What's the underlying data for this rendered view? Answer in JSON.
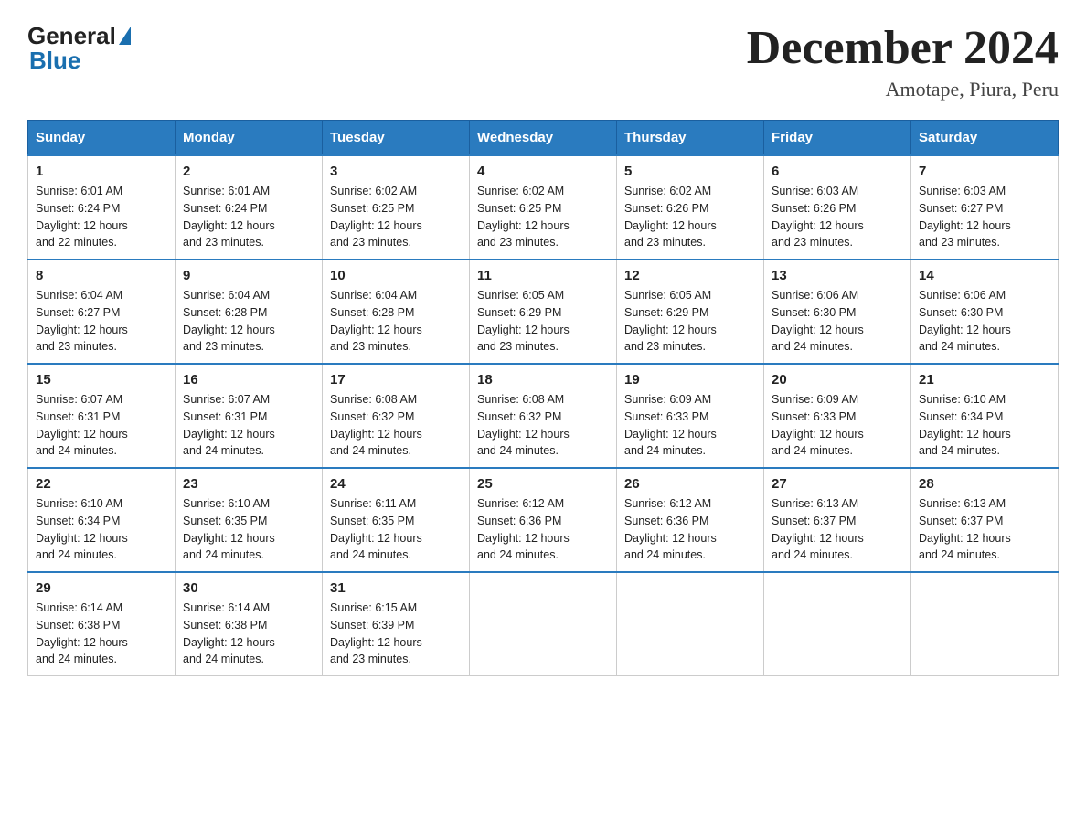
{
  "header": {
    "logo_general": "General",
    "logo_blue": "Blue",
    "month_year": "December 2024",
    "location": "Amotape, Piura, Peru"
  },
  "days_of_week": [
    "Sunday",
    "Monday",
    "Tuesday",
    "Wednesday",
    "Thursday",
    "Friday",
    "Saturday"
  ],
  "weeks": [
    [
      {
        "num": "1",
        "sunrise": "6:01 AM",
        "sunset": "6:24 PM",
        "daylight": "12 hours and 22 minutes."
      },
      {
        "num": "2",
        "sunrise": "6:01 AM",
        "sunset": "6:24 PM",
        "daylight": "12 hours and 23 minutes."
      },
      {
        "num": "3",
        "sunrise": "6:02 AM",
        "sunset": "6:25 PM",
        "daylight": "12 hours and 23 minutes."
      },
      {
        "num": "4",
        "sunrise": "6:02 AM",
        "sunset": "6:25 PM",
        "daylight": "12 hours and 23 minutes."
      },
      {
        "num": "5",
        "sunrise": "6:02 AM",
        "sunset": "6:26 PM",
        "daylight": "12 hours and 23 minutes."
      },
      {
        "num": "6",
        "sunrise": "6:03 AM",
        "sunset": "6:26 PM",
        "daylight": "12 hours and 23 minutes."
      },
      {
        "num": "7",
        "sunrise": "6:03 AM",
        "sunset": "6:27 PM",
        "daylight": "12 hours and 23 minutes."
      }
    ],
    [
      {
        "num": "8",
        "sunrise": "6:04 AM",
        "sunset": "6:27 PM",
        "daylight": "12 hours and 23 minutes."
      },
      {
        "num": "9",
        "sunrise": "6:04 AM",
        "sunset": "6:28 PM",
        "daylight": "12 hours and 23 minutes."
      },
      {
        "num": "10",
        "sunrise": "6:04 AM",
        "sunset": "6:28 PM",
        "daylight": "12 hours and 23 minutes."
      },
      {
        "num": "11",
        "sunrise": "6:05 AM",
        "sunset": "6:29 PM",
        "daylight": "12 hours and 23 minutes."
      },
      {
        "num": "12",
        "sunrise": "6:05 AM",
        "sunset": "6:29 PM",
        "daylight": "12 hours and 23 minutes."
      },
      {
        "num": "13",
        "sunrise": "6:06 AM",
        "sunset": "6:30 PM",
        "daylight": "12 hours and 24 minutes."
      },
      {
        "num": "14",
        "sunrise": "6:06 AM",
        "sunset": "6:30 PM",
        "daylight": "12 hours and 24 minutes."
      }
    ],
    [
      {
        "num": "15",
        "sunrise": "6:07 AM",
        "sunset": "6:31 PM",
        "daylight": "12 hours and 24 minutes."
      },
      {
        "num": "16",
        "sunrise": "6:07 AM",
        "sunset": "6:31 PM",
        "daylight": "12 hours and 24 minutes."
      },
      {
        "num": "17",
        "sunrise": "6:08 AM",
        "sunset": "6:32 PM",
        "daylight": "12 hours and 24 minutes."
      },
      {
        "num": "18",
        "sunrise": "6:08 AM",
        "sunset": "6:32 PM",
        "daylight": "12 hours and 24 minutes."
      },
      {
        "num": "19",
        "sunrise": "6:09 AM",
        "sunset": "6:33 PM",
        "daylight": "12 hours and 24 minutes."
      },
      {
        "num": "20",
        "sunrise": "6:09 AM",
        "sunset": "6:33 PM",
        "daylight": "12 hours and 24 minutes."
      },
      {
        "num": "21",
        "sunrise": "6:10 AM",
        "sunset": "6:34 PM",
        "daylight": "12 hours and 24 minutes."
      }
    ],
    [
      {
        "num": "22",
        "sunrise": "6:10 AM",
        "sunset": "6:34 PM",
        "daylight": "12 hours and 24 minutes."
      },
      {
        "num": "23",
        "sunrise": "6:10 AM",
        "sunset": "6:35 PM",
        "daylight": "12 hours and 24 minutes."
      },
      {
        "num": "24",
        "sunrise": "6:11 AM",
        "sunset": "6:35 PM",
        "daylight": "12 hours and 24 minutes."
      },
      {
        "num": "25",
        "sunrise": "6:12 AM",
        "sunset": "6:36 PM",
        "daylight": "12 hours and 24 minutes."
      },
      {
        "num": "26",
        "sunrise": "6:12 AM",
        "sunset": "6:36 PM",
        "daylight": "12 hours and 24 minutes."
      },
      {
        "num": "27",
        "sunrise": "6:13 AM",
        "sunset": "6:37 PM",
        "daylight": "12 hours and 24 minutes."
      },
      {
        "num": "28",
        "sunrise": "6:13 AM",
        "sunset": "6:37 PM",
        "daylight": "12 hours and 24 minutes."
      }
    ],
    [
      {
        "num": "29",
        "sunrise": "6:14 AM",
        "sunset": "6:38 PM",
        "daylight": "12 hours and 24 minutes."
      },
      {
        "num": "30",
        "sunrise": "6:14 AM",
        "sunset": "6:38 PM",
        "daylight": "12 hours and 24 minutes."
      },
      {
        "num": "31",
        "sunrise": "6:15 AM",
        "sunset": "6:39 PM",
        "daylight": "12 hours and 23 minutes."
      },
      null,
      null,
      null,
      null
    ]
  ],
  "labels": {
    "sunrise": "Sunrise:",
    "sunset": "Sunset:",
    "daylight": "Daylight: 12 hours"
  }
}
